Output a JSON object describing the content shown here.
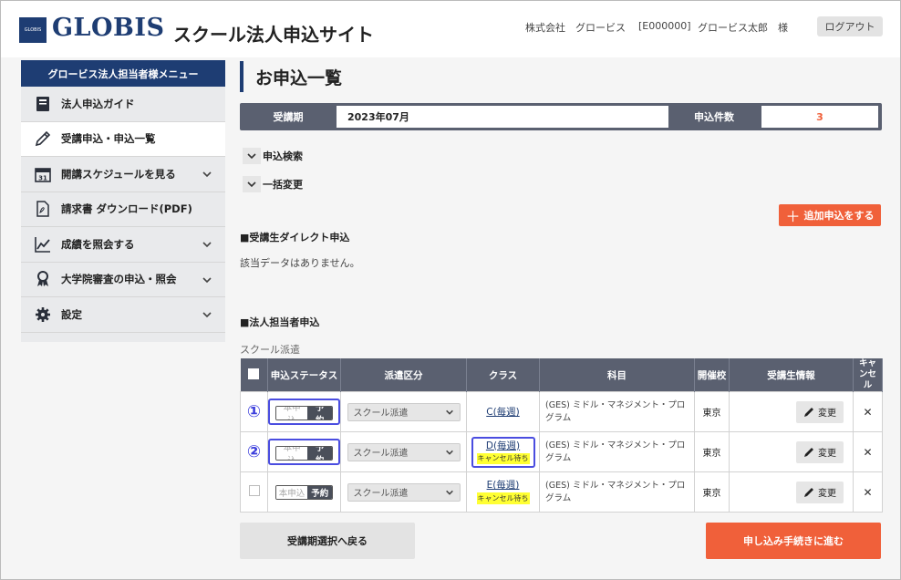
{
  "header": {
    "logo_mark": "GLOBIS",
    "logo": "GLOBIS",
    "site_title": "スクール法人申込サイト",
    "company": "株式会社　グロービス",
    "code": "[E000000]",
    "user": "グロービス太郎　様",
    "logout": "ログアウト"
  },
  "sidebar": {
    "title": "グロービス法人担当者様メニュー",
    "items": [
      {
        "label": "法人申込ガイド",
        "icon": "book-icon",
        "expandable": false
      },
      {
        "label": "受講申込・申込一覧",
        "icon": "pencil-icon",
        "expandable": false,
        "active": true
      },
      {
        "label": "開講スケジュールを見る",
        "icon": "calendar-icon",
        "expandable": true,
        "calendar_day": "31"
      },
      {
        "label": "請求書 ダウンロード(PDF)",
        "icon": "pdf-file-icon",
        "expandable": false
      },
      {
        "label": "成績を照会する",
        "icon": "chart-line-icon",
        "expandable": true
      },
      {
        "label": "大学院審査の申込・照会",
        "icon": "award-icon",
        "expandable": true
      },
      {
        "label": "設定",
        "icon": "gear-icon",
        "expandable": true
      }
    ]
  },
  "main": {
    "page_title": "お申込一覧",
    "period_label": "受講期",
    "period_value": "2023年07月",
    "count_label": "申込件数",
    "count_value": "3",
    "toggle_search": "申込検索",
    "toggle_bulk": "一括変更",
    "add_button": "追加申込をする",
    "direct_heading": "■受講生ダイレクト申込",
    "no_data": "該当データはありません。",
    "corp_heading": "■法人担当者申込",
    "school_dispatch": "スクール派遣"
  },
  "table": {
    "headers": [
      "申込ステータス",
      "派遣区分",
      "クラス",
      "科目",
      "開催校",
      "受講生情報",
      "キャンセル"
    ],
    "rows": [
      {
        "marker": "①",
        "status_off": "本申込",
        "status_on": "予約",
        "dispatch": "スクール派遣",
        "class": "C(毎週)",
        "cancel_wait": "",
        "subject": "(GES) ミドル・マネジメント・プログラム",
        "school": "東京",
        "change": "変更"
      },
      {
        "marker": "②",
        "status_off": "本申込",
        "status_on": "予約",
        "dispatch": "スクール派遣",
        "class": "D(毎週)",
        "cancel_wait": "キャンセル待ち",
        "subject": "(GES) ミドル・マネジメント・プログラム",
        "school": "東京",
        "change": "変更"
      },
      {
        "marker": "",
        "status_off": "本申込",
        "status_on": "予約",
        "dispatch": "スクール派遣",
        "class": "E(毎週)",
        "cancel_wait": "キャンセル待ち",
        "subject": "(GES) ミドル・マネジメント・プログラム",
        "school": "東京",
        "change": "変更"
      }
    ]
  },
  "footer": {
    "back": "受講期選択へ戻る",
    "proceed": "申し込み手続きに進む"
  },
  "colors": {
    "brand_navy": "#1e3d73",
    "accent_orange": "#f0603a",
    "highlight_blue": "#4a4de0",
    "header_gray": "#5a6070"
  }
}
